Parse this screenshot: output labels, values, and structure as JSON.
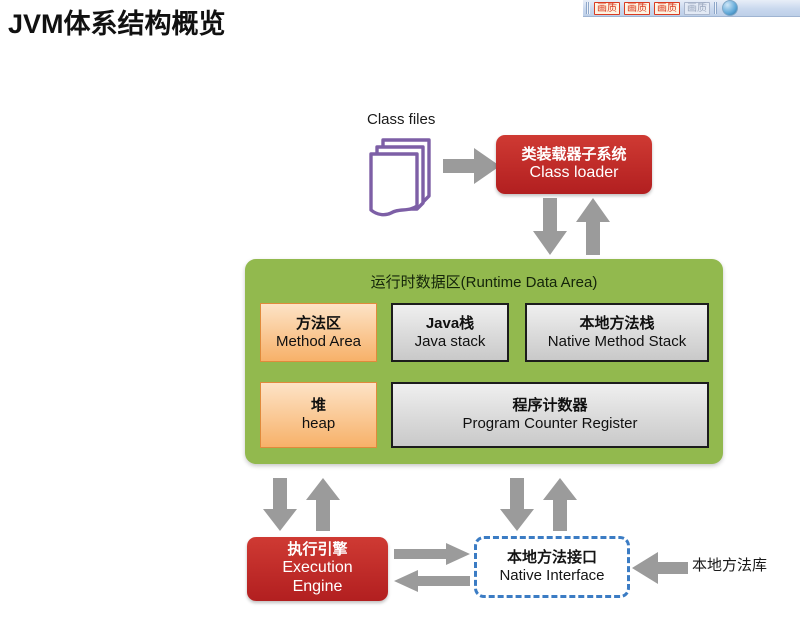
{
  "page": {
    "title": "JVM体系结构概览"
  },
  "toolbar": {
    "buttons": [
      {
        "label": "画质",
        "state": "active"
      },
      {
        "label": "画质",
        "state": "active"
      },
      {
        "label": "画质",
        "state": "active"
      },
      {
        "label": "画质",
        "state": "dim"
      }
    ]
  },
  "diagram": {
    "class_files": {
      "label": "Class files",
      "icon": "stacked-documents-icon",
      "icon_color": "#7d5fa6"
    },
    "class_loader": {
      "cn": "类装载器子系统",
      "en": "Class loader",
      "color": "#c0252b"
    },
    "runtime_data_area": {
      "title": "运行时数据区(Runtime Data Area)",
      "color": "#92b94e",
      "cells": [
        {
          "cn": "方法区",
          "en": "Method Area",
          "style": "orange"
        },
        {
          "cn": "Java栈",
          "en": "Java stack",
          "style": "gray"
        },
        {
          "cn": "本地方法栈",
          "en": "Native Method Stack",
          "style": "gray"
        },
        {
          "cn": "堆",
          "en": "heap",
          "style": "orange"
        },
        {
          "cn": "程序计数器",
          "en": "Program Counter Register",
          "style": "gray"
        }
      ]
    },
    "execution_engine": {
      "cn": "执行引擎",
      "en": "Execution",
      "en2": "Engine",
      "color": "#c0252b"
    },
    "native_interface": {
      "cn": "本地方法接口",
      "en": "Native Interface",
      "border_color": "#3b7cc4"
    },
    "native_library": {
      "label": "本地方法库"
    },
    "arrow_color": "#9b9b9b"
  }
}
